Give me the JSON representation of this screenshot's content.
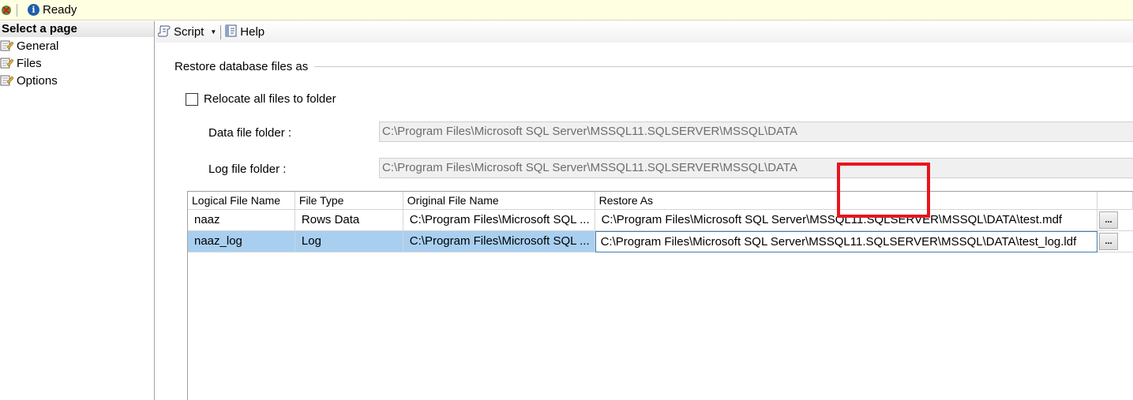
{
  "status": {
    "text": "Ready",
    "error_icon": "error-x-icon",
    "info_icon": "info-icon"
  },
  "left_pane": {
    "header": "Select a page",
    "items": [
      {
        "label": "General",
        "icon": "page-icon"
      },
      {
        "label": "Files",
        "icon": "page-icon"
      },
      {
        "label": "Options",
        "icon": "page-icon"
      }
    ]
  },
  "toolbar": {
    "script_label": "Script",
    "help_label": "Help"
  },
  "main": {
    "section_title": "Restore database files as",
    "relocate_label": "Relocate all files to folder",
    "relocate_checked": false,
    "data_folder_label": "Data file folder :",
    "data_folder_value": "C:\\Program Files\\Microsoft SQL Server\\MSSQL11.SQLSERVER\\MSSQL\\DATA",
    "log_folder_label": "Log file folder :",
    "log_folder_value": "C:\\Program Files\\Microsoft SQL Server\\MSSQL11.SQLSERVER\\MSSQL\\DATA"
  },
  "grid": {
    "columns": [
      "Logical File Name",
      "File Type",
      "Original File Name",
      "Restore As"
    ],
    "rows": [
      {
        "logical": "naaz",
        "type": "Rows Data",
        "original": "C:\\Program Files\\Microsoft SQL ...",
        "restore_as": "C:\\Program Files\\Microsoft SQL Server\\MSSQL11.SQLSERVER\\MSSQL\\DATA\\test.mdf",
        "browse": "..."
      },
      {
        "logical": "naaz_log",
        "type": "Log",
        "original": "C:\\Program Files\\Microsoft SQL ...",
        "restore_as": "C:\\Program Files\\Microsoft SQL Server\\MSSQL11.SQLSERVER\\MSSQL\\DATA\\test_log.ldf",
        "browse": "..."
      }
    ],
    "selected_row": 1
  },
  "colors": {
    "status_bg": "#ffffe1",
    "selection": "#a9cff0",
    "highlight": "#e8141e"
  }
}
